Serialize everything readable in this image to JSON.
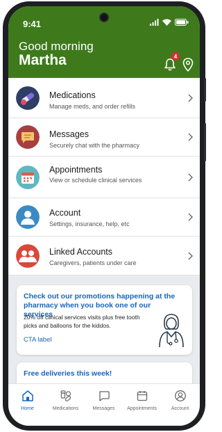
{
  "status": {
    "time": "9:41"
  },
  "header": {
    "greeting": "Good morning",
    "name": "Martha",
    "notification_count": "4"
  },
  "menu": [
    {
      "title": "Medications",
      "subtitle": "Manage meds, and order refills",
      "icon": "pills-icon"
    },
    {
      "title": "Messages",
      "subtitle": "Securely chat with the pharmacy",
      "icon": "chat-icon"
    },
    {
      "title": "Appointments",
      "subtitle": "View or schedule clinical services",
      "icon": "calendar-icon"
    },
    {
      "title": "Account",
      "subtitle": "Settings, insurance, help, etc",
      "icon": "person-icon"
    },
    {
      "title": "Linked Accounts",
      "subtitle": "Caregivers, patients under care",
      "icon": "people-icon"
    }
  ],
  "promos": [
    {
      "title": "Check out our promotions happening at the pharmacy when you book one of our services",
      "text": "20% off clinical services visits plus free tooth picks and balloons for the kiddos.",
      "cta": "CTA label"
    },
    {
      "title": "Free deliveries this week!"
    }
  ],
  "bottom_nav": [
    {
      "label": "Home",
      "icon": "home-icon",
      "active": true
    },
    {
      "label": "Medications",
      "icon": "medications-icon",
      "active": false
    },
    {
      "label": "Messages",
      "icon": "message-icon",
      "active": false
    },
    {
      "label": "Appointments",
      "icon": "calendar-icon",
      "active": false
    },
    {
      "label": "Account",
      "icon": "account-icon",
      "active": false
    }
  ],
  "colors": {
    "header_green": "#3e7a1c",
    "accent_blue": "#1565c0",
    "badge_red": "#d32f2f"
  }
}
